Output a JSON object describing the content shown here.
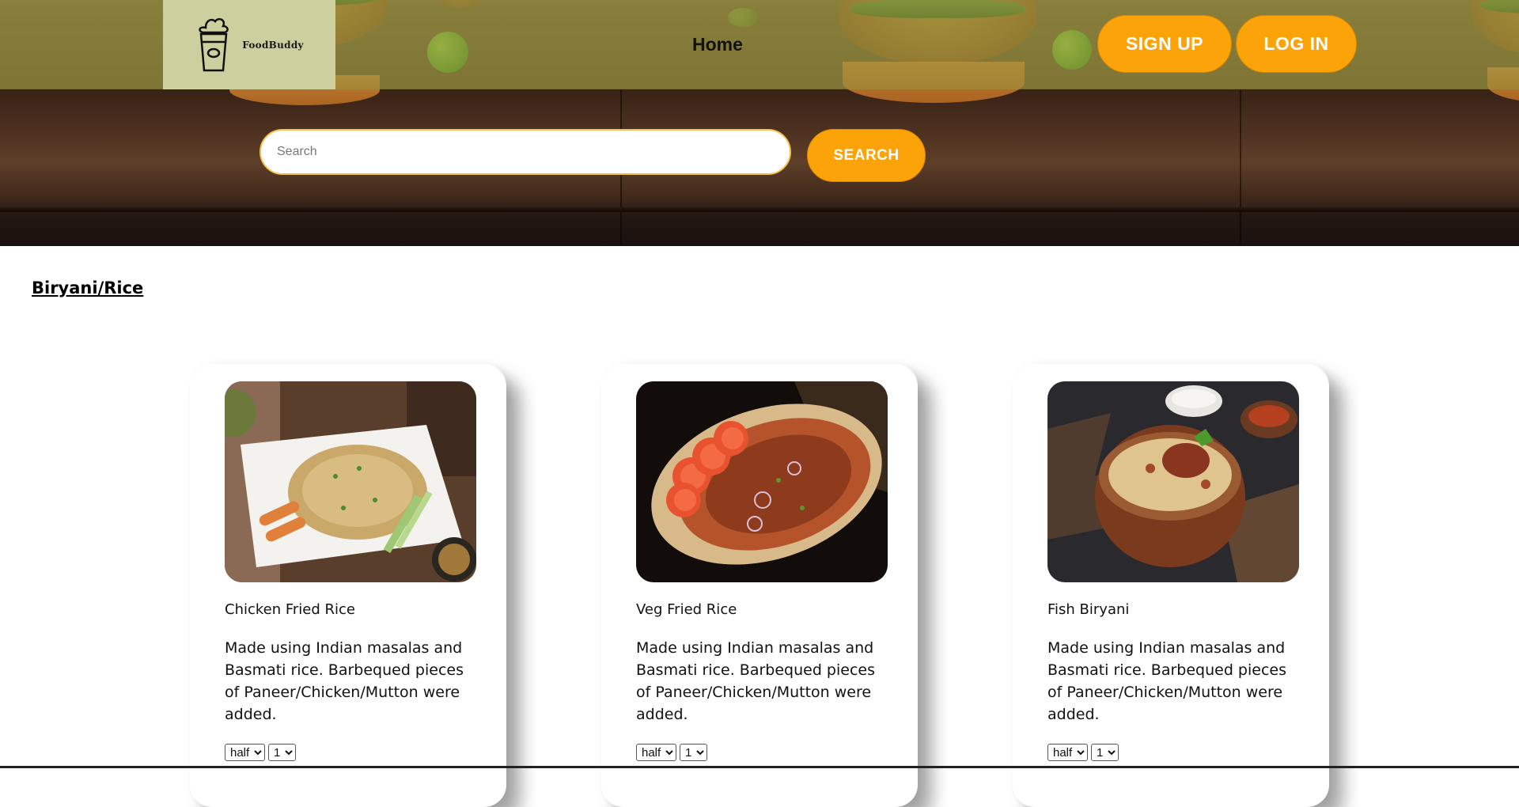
{
  "header": {
    "logo_text": "FoodBuddy",
    "nav": {
      "home_label": "Home"
    },
    "signup_label": "SIGN UP",
    "login_label": "LOG IN"
  },
  "search": {
    "placeholder": "Search",
    "value": "",
    "button_label": "SEARCH"
  },
  "colors": {
    "accent_orange": "#fda30a",
    "logo_bg": "#cdcf9f"
  },
  "category": {
    "title": "Biryani/Rice",
    "items": [
      {
        "name": "Chicken Fried Rice",
        "description": "Made using Indian masalas and Basmati rice. Barbequed pieces of Paneer/Chicken/Mutton were added.",
        "portion_selected": "half",
        "quantity_selected": "1"
      },
      {
        "name": "Veg Fried Rice",
        "description": "Made using Indian masalas and Basmati rice. Barbequed pieces of Paneer/Chicken/Mutton were added.",
        "portion_selected": "half",
        "quantity_selected": "1"
      },
      {
        "name": "Fish Biryani",
        "description": "Made using Indian masalas and Basmati rice. Barbequed pieces of Paneer/Chicken/Mutton were added.",
        "portion_selected": "half",
        "quantity_selected": "1"
      }
    ]
  }
}
